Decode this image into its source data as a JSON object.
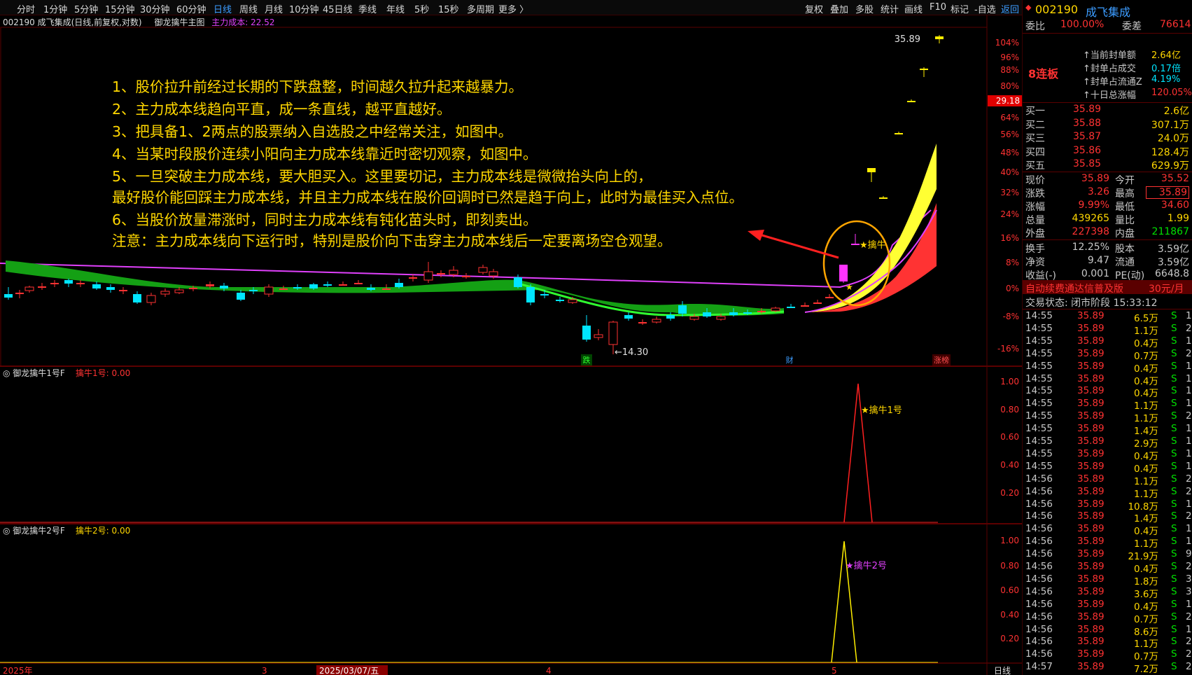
{
  "toolbar": {
    "left": [
      "分时",
      "1分钟",
      "5分钟",
      "15分钟",
      "30分钟",
      "60分钟",
      "日线",
      "周线",
      "月线",
      "10分钟",
      "45日线",
      "季线",
      "年线",
      "5秒",
      "15秒",
      "多周期",
      "更多 〉"
    ],
    "right": [
      "复权",
      "叠加",
      "多股",
      "统计",
      "画线",
      "F10",
      "标记",
      "-自选",
      "返回"
    ]
  },
  "main_header": {
    "code_name": "002190 成飞集成(日线,前复权,对数)",
    "indicator": "御龙擒牛主图",
    "cost_label": "主力成本: 22.52"
  },
  "annotations": [
    "1、股价拉升前经过长期的下跌盘整，时间越久拉升起来越暴力。",
    "2、主力成本线趋向平直，成一条直线，越平直越好。",
    "3、把具备1、2两点的股票纳入自选股之中经常关注，如图中。",
    "4、当某时段股价连续小阳向主力成本线靠近时密切观察，如图中。",
    "5、一旦突破主力成本线，要大胆买入。这里要切记，主力成本线是微微抬头向上的，",
    "最好股价能回踩主力成本线，并且主力成本线在股价回调时已然是趋于向上，此时为最佳买入点位。",
    "6、当股价放量滞涨时，同时主力成本线有钝化苗头时，即刻卖出。",
    "注意：主力成本线向下运行时，特别是股价向下击穿主力成本线后一定要离场空仓观望。"
  ],
  "main_axis": [
    "104%",
    "96%",
    "88%",
    "80%",
    "72%",
    "64%",
    "56%",
    "48%",
    "40%",
    "32%",
    "24%",
    "16%",
    "8%",
    "0%",
    "-8%",
    "-16%"
  ],
  "price_marks": {
    "high": "35.89",
    "low": "←14.30",
    "current": "29.18",
    "signal": "★擒牛",
    "sig_small": "★"
  },
  "event_marks": {
    "die": "跌",
    "cai": "财",
    "zhangbang": "涨榜"
  },
  "sub1": {
    "title": "御龙擒牛1号F",
    "value": "擒牛1号: 0.00",
    "label": "★擒牛1号",
    "axis": [
      "1.00",
      "0.80",
      "0.60",
      "0.40",
      "0.20"
    ]
  },
  "sub2": {
    "title": "御龙擒牛2号F",
    "value": "擒牛2号: 0.00",
    "label": "★擒牛2号",
    "axis": [
      "1.00",
      "0.80",
      "0.60",
      "0.40",
      "0.20"
    ]
  },
  "date_axis": {
    "y2025": "2025年",
    "m3": "3",
    "sel": "2025/03/07/五",
    "m4": "4",
    "m5": "5",
    "period": "日线"
  },
  "quote": {
    "code": "002190",
    "name": "成飞集成",
    "weibi_label": "委比",
    "weibi": "100.00%",
    "weicha_label": "委差",
    "weicha": "76614",
    "lianban": "8连板",
    "seal": [
      [
        "当前封单额",
        "2.64亿"
      ],
      [
        "封单占成交",
        "0.17倍"
      ],
      [
        "封单占流通Z",
        "4.19%"
      ],
      [
        "十日总涨幅",
        "120.05%"
      ]
    ],
    "book": [
      [
        "买一",
        "35.89",
        "2.6亿"
      ],
      [
        "买二",
        "35.88",
        "307.1万"
      ],
      [
        "买三",
        "35.87",
        "24.0万"
      ],
      [
        "买四",
        "35.86",
        "128.4万"
      ],
      [
        "买五",
        "35.85",
        "629.9万"
      ]
    ],
    "stats": [
      [
        "现价",
        "35.89",
        "今开",
        "35.52"
      ],
      [
        "涨跌",
        "3.26",
        "最高",
        "35.89"
      ],
      [
        "涨幅",
        "9.99%",
        "最低",
        "34.60"
      ],
      [
        "总量",
        "439265",
        "量比",
        "1.99"
      ],
      [
        "外盘",
        "227398",
        "内盘",
        "211867"
      ]
    ],
    "stats2": [
      [
        "换手",
        "12.25%",
        "股本",
        "3.59亿"
      ],
      [
        "净资",
        "9.47",
        "流通",
        "3.59亿"
      ],
      [
        "收益(-)",
        "0.001",
        "PE(动)",
        "6648.8"
      ]
    ],
    "promo": "自动续费通达信普及版",
    "promo_price": "30元/月",
    "status": "交易状态: 闭市阶段 15:33:12"
  },
  "ticks": [
    [
      "14:55",
      "35.89",
      "6.5万",
      "S",
      "1"
    ],
    [
      "14:55",
      "35.89",
      "1.1万",
      "S",
      "2"
    ],
    [
      "14:55",
      "35.89",
      "0.4万",
      "S",
      "1"
    ],
    [
      "14:55",
      "35.89",
      "0.7万",
      "S",
      "2"
    ],
    [
      "14:55",
      "35.89",
      "0.4万",
      "S",
      "1"
    ],
    [
      "14:55",
      "35.89",
      "0.4万",
      "S",
      "1"
    ],
    [
      "14:55",
      "35.89",
      "0.4万",
      "S",
      "1"
    ],
    [
      "14:55",
      "35.89",
      "1.1万",
      "S",
      "1"
    ],
    [
      "14:55",
      "35.89",
      "1.1万",
      "S",
      "2"
    ],
    [
      "14:55",
      "35.89",
      "1.4万",
      "S",
      "1"
    ],
    [
      "14:55",
      "35.89",
      "2.9万",
      "S",
      "1"
    ],
    [
      "14:55",
      "35.89",
      "0.4万",
      "S",
      "1"
    ],
    [
      "14:55",
      "35.89",
      "0.4万",
      "S",
      "1"
    ],
    [
      "14:56",
      "35.89",
      "1.1万",
      "S",
      "2"
    ],
    [
      "14:56",
      "35.89",
      "1.1万",
      "S",
      "2"
    ],
    [
      "14:56",
      "35.89",
      "10.8万",
      "S",
      "1"
    ],
    [
      "14:56",
      "35.89",
      "1.4万",
      "S",
      "2"
    ],
    [
      "14:56",
      "35.89",
      "0.4万",
      "S",
      "1"
    ],
    [
      "14:56",
      "35.89",
      "1.1万",
      "S",
      "1"
    ],
    [
      "14:56",
      "35.89",
      "21.9万",
      "S",
      "9"
    ],
    [
      "14:56",
      "35.89",
      "0.4万",
      "S",
      "2"
    ],
    [
      "14:56",
      "35.89",
      "1.8万",
      "S",
      "3"
    ],
    [
      "14:56",
      "35.89",
      "3.6万",
      "S",
      "3"
    ],
    [
      "14:56",
      "35.89",
      "0.4万",
      "S",
      "1"
    ],
    [
      "14:56",
      "35.89",
      "0.7万",
      "S",
      "2"
    ],
    [
      "14:56",
      "35.89",
      "8.6万",
      "S",
      "1"
    ],
    [
      "14:56",
      "35.89",
      "1.1万",
      "S",
      "2"
    ],
    [
      "14:56",
      "35.89",
      "0.7万",
      "S",
      "2"
    ],
    [
      "14:57",
      "35.89",
      "7.2万",
      "S",
      "2"
    ]
  ]
}
